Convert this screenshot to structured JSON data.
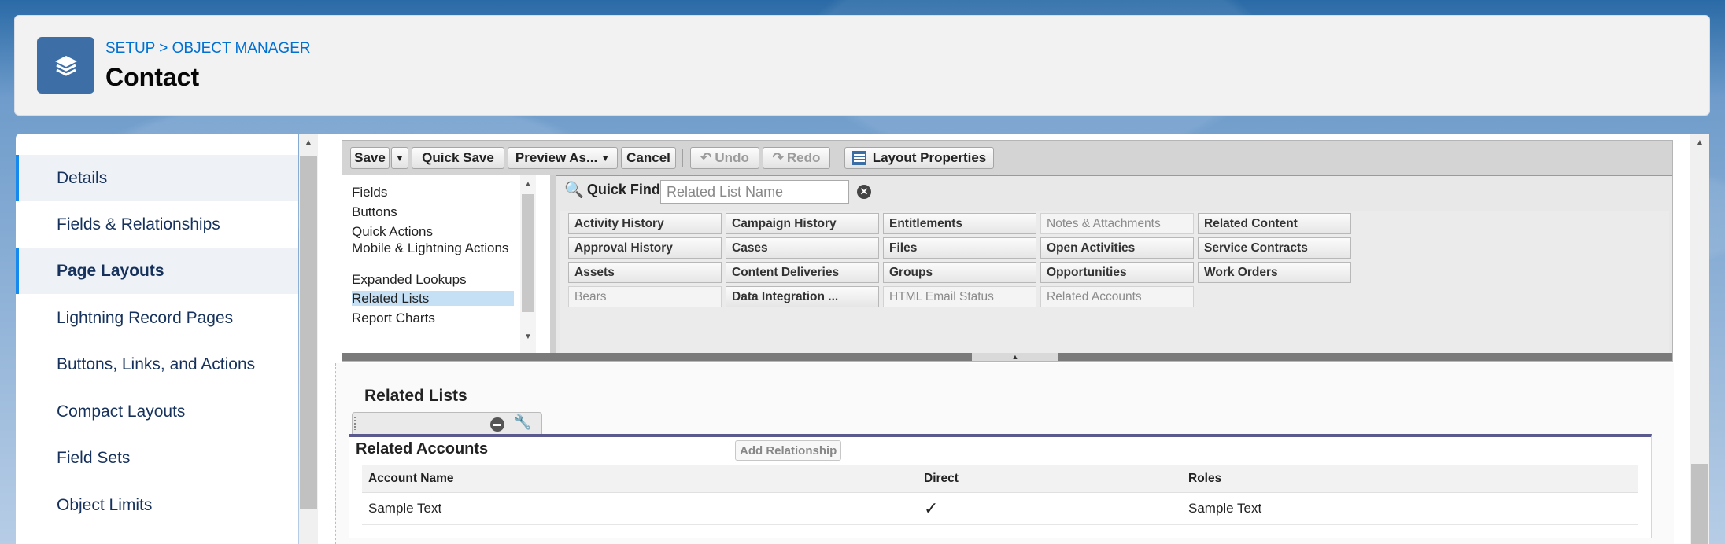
{
  "header": {
    "breadcrumb": "SETUP > OBJECT MANAGER",
    "title": "Contact"
  },
  "sidebar": {
    "items": [
      {
        "label": "Details"
      },
      {
        "label": "Fields & Relationships"
      },
      {
        "label": "Page Layouts"
      },
      {
        "label": "Lightning Record Pages"
      },
      {
        "label": "Buttons, Links, and Actions"
      },
      {
        "label": "Compact Layouts"
      },
      {
        "label": "Field Sets"
      },
      {
        "label": "Object Limits"
      }
    ]
  },
  "toolbar": {
    "save": "Save",
    "quick_save": "Quick Save",
    "preview_as": "Preview As...",
    "cancel": "Cancel",
    "undo": "Undo",
    "redo": "Redo",
    "layout_properties": "Layout Properties"
  },
  "palette": {
    "categories": [
      "Fields",
      "Buttons",
      "Quick Actions",
      "Mobile & Lightning Actions",
      "Expanded Lookups",
      "Related Lists",
      "Report Charts"
    ],
    "quick_find_label": "Quick Find",
    "quick_find_placeholder": "Related List Name",
    "items": [
      [
        "Activity History",
        "Campaign History",
        "Entitlements",
        "Notes & Attachments",
        "Related Content"
      ],
      [
        "Approval History",
        "Cases",
        "Files",
        "Open Activities",
        "Service Contracts"
      ],
      [
        "Assets",
        "Content Deliveries",
        "Groups",
        "Opportunities",
        "Work Orders"
      ],
      [
        "Bears",
        "Data Integration ...",
        "HTML Email Status",
        "Related Accounts",
        ""
      ]
    ]
  },
  "layout": {
    "section_title": "Related Lists",
    "related_list": {
      "name": "Related Accounts",
      "add_button": "Add Relationship",
      "columns": [
        "Account Name",
        "Direct",
        "Roles"
      ],
      "rows": [
        {
          "account_name": "Sample Text",
          "direct": "✓",
          "roles": "Sample Text"
        }
      ]
    }
  },
  "colors": {
    "accent": "#0070d2",
    "active_border": "#1589ee",
    "icon_bg": "#3d6fa6",
    "related_list_bar": "#5b5a8e"
  }
}
